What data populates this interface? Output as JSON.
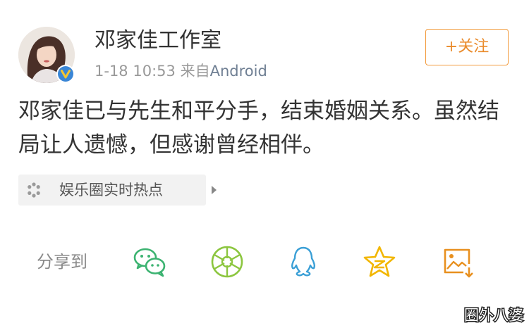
{
  "post": {
    "author": "邓家佳工作室",
    "date": "1-18",
    "time": "10:53",
    "source_prefix": "来自",
    "source_app": "Android",
    "follow_label": "+关注",
    "text": "邓家佳已与先生和平分手，结束婚姻关系。虽然结局让人遗憾，但感谢曾经相伴。"
  },
  "topic": {
    "label": "娱乐圈实时热点",
    "icon": "spinner-icon"
  },
  "share": {
    "label": "分享到",
    "targets": [
      {
        "name": "wechat",
        "icon": "wechat-icon"
      },
      {
        "name": "moments",
        "icon": "moments-icon"
      },
      {
        "name": "qq",
        "icon": "qq-icon"
      },
      {
        "name": "qzone",
        "icon": "qzone-icon"
      },
      {
        "name": "save-image",
        "icon": "image-download-icon"
      }
    ]
  },
  "watermark": "圈外八婆",
  "colors": {
    "text": "#333333",
    "meta": "#999999",
    "follow_orange": "#ea8b2b",
    "share_green": "#3cb371",
    "share_blue": "#3a9fd6",
    "share_yellow": "#f2b600",
    "share_orange": "#e8901f"
  }
}
